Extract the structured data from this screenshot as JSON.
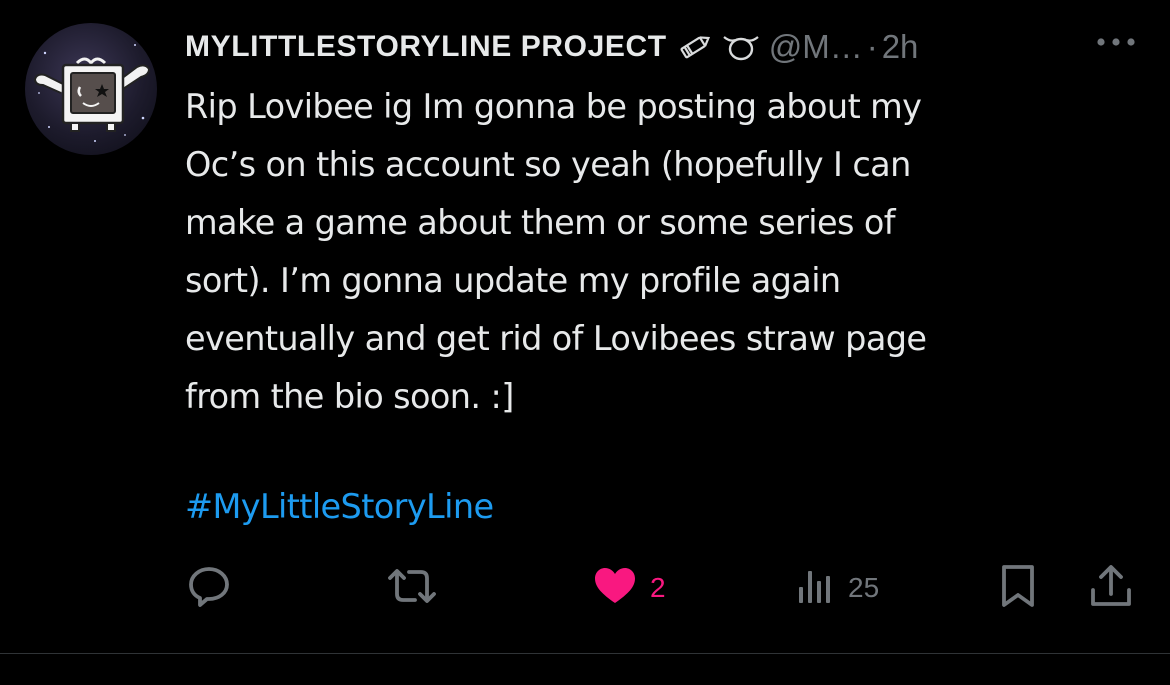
{
  "tweet": {
    "display_name": "MYLITTLESTORYLINE PROJECT",
    "handle": "@M…",
    "separator": "·",
    "time": "2h",
    "text_lines": [
      "Rip Lovibee ig Im gonna be posting about my",
      "Oc’s on this account so yeah (hopefully I can",
      "make a game about them or some series of",
      "sort). I’m gonna update my profile again",
      "eventually and get rid of Lovibees straw page",
      "from the bio soon. :]"
    ],
    "hashtag": "#MyLittleStoryLine",
    "name_emojis": [
      "pencil-icon",
      "curly-loop-icon"
    ]
  },
  "actions": {
    "reply": {
      "icon": "reply-icon"
    },
    "retweet": {
      "icon": "retweet-icon"
    },
    "like": {
      "icon": "heart-filled-icon",
      "count": "2"
    },
    "views": {
      "icon": "views-icon",
      "count": "25"
    },
    "bookmark": {
      "icon": "bookmark-icon"
    },
    "share": {
      "icon": "share-icon"
    }
  },
  "colors": {
    "background": "#000000",
    "text": "#e7e9ea",
    "secondary": "#71767b",
    "link": "#1d9bf0",
    "like": "#f91880",
    "divider": "#2f3336"
  }
}
